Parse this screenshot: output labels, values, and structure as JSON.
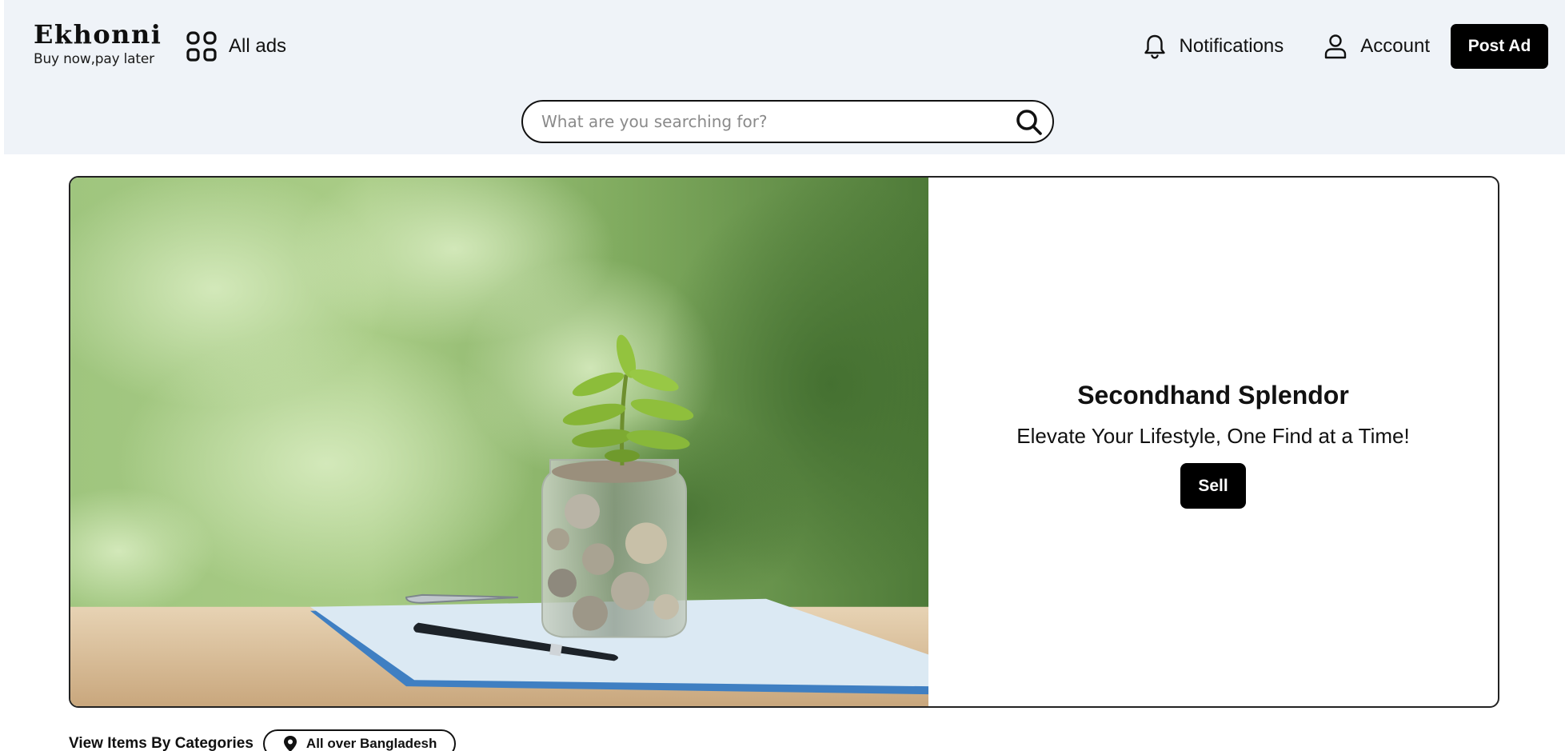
{
  "brand": {
    "name": "Ekhonni",
    "tagline": "Buy now,pay later"
  },
  "nav": {
    "all_ads": "All ads",
    "notifications": "Notifications",
    "account": "Account",
    "post_ad": "Post Ad"
  },
  "search": {
    "placeholder": "What are you searching for?"
  },
  "hero": {
    "title": "Secondhand Splendor",
    "subtitle": "Elevate Your Lifestyle, One Find at a Time!",
    "cta": "Sell",
    "image_alt": "Plant growing from a jar of coins on papers with a pen"
  },
  "categories": {
    "label": "View Items By Categories",
    "location": "All over Bangladesh"
  },
  "icons": {
    "all_ads": "grid-icon",
    "notifications": "bell-icon",
    "account": "user-icon",
    "search": "search-icon",
    "location": "map-pin-icon"
  },
  "colors": {
    "header_bg": "#eff3f8",
    "button_bg": "#000000",
    "button_text": "#ffffff"
  }
}
